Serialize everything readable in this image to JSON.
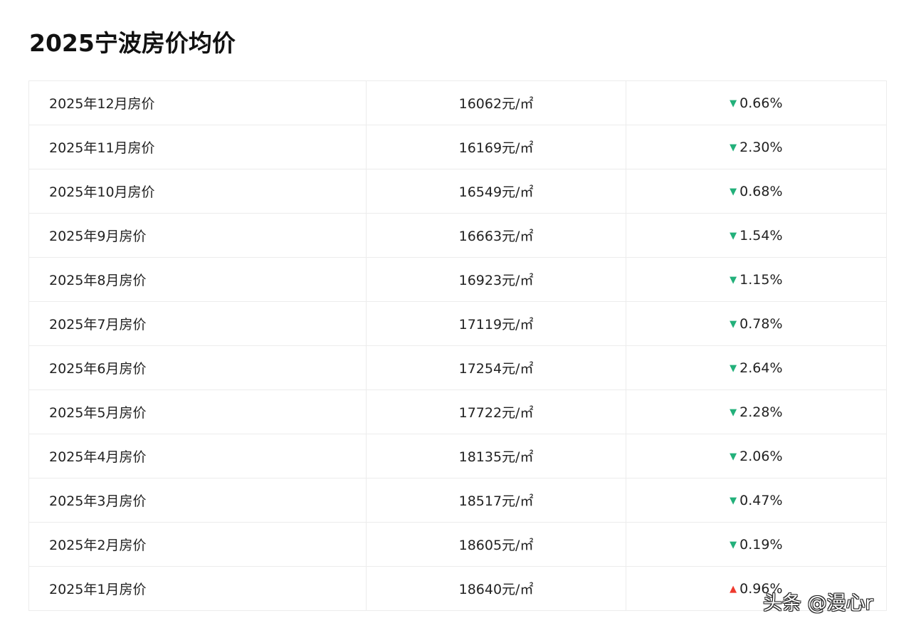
{
  "title": "2025宁波房价均价",
  "colors": {
    "down": "#22b07a",
    "up": "#ee3a2e"
  },
  "rows": [
    {
      "month": "2025年12月房价",
      "price": "16062元/㎡",
      "direction": "down",
      "change": "0.66%"
    },
    {
      "month": "2025年11月房价",
      "price": "16169元/㎡",
      "direction": "down",
      "change": "2.30%"
    },
    {
      "month": "2025年10月房价",
      "price": "16549元/㎡",
      "direction": "down",
      "change": "0.68%"
    },
    {
      "month": "2025年9月房价",
      "price": "16663元/㎡",
      "direction": "down",
      "change": "1.54%"
    },
    {
      "month": "2025年8月房价",
      "price": "16923元/㎡",
      "direction": "down",
      "change": "1.15%"
    },
    {
      "month": "2025年7月房价",
      "price": "17119元/㎡",
      "direction": "down",
      "change": "0.78%"
    },
    {
      "month": "2025年6月房价",
      "price": "17254元/㎡",
      "direction": "down",
      "change": "2.64%"
    },
    {
      "month": "2025年5月房价",
      "price": "17722元/㎡",
      "direction": "down",
      "change": "2.28%"
    },
    {
      "month": "2025年4月房价",
      "price": "18135元/㎡",
      "direction": "down",
      "change": "2.06%"
    },
    {
      "month": "2025年3月房价",
      "price": "18517元/㎡",
      "direction": "down",
      "change": "0.47%"
    },
    {
      "month": "2025年2月房价",
      "price": "18605元/㎡",
      "direction": "down",
      "change": "0.19%"
    },
    {
      "month": "2025年1月房价",
      "price": "18640元/㎡",
      "direction": "up",
      "change": "0.96%"
    }
  ],
  "watermark": "头条 @漫心r"
}
